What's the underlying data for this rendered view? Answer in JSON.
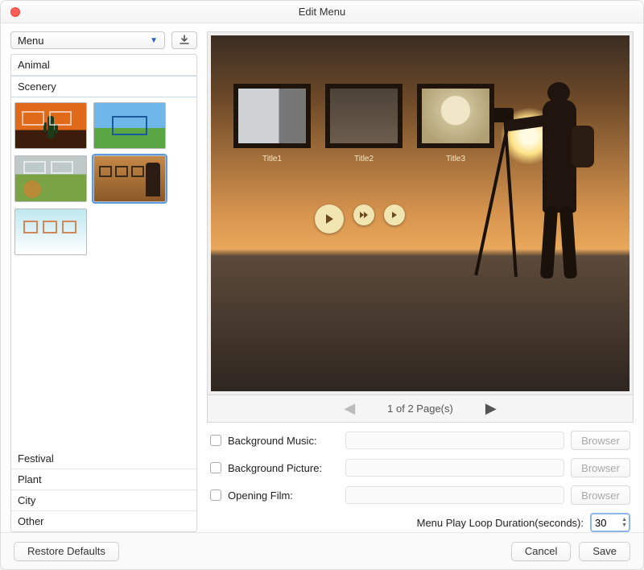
{
  "window": {
    "title": "Edit Menu"
  },
  "sidebar": {
    "combo_value": "Menu",
    "download_icon": "download-icon",
    "categories_top": [
      "Animal",
      "Scenery"
    ],
    "selected_category": "Scenery",
    "categories_bottom": [
      "Festival",
      "Plant",
      "City",
      "Other"
    ]
  },
  "preview": {
    "titles": [
      "Title1",
      "Title2",
      "Title3"
    ],
    "controls": {
      "play": "play-icon",
      "skip": "skip-icon",
      "next": "next-icon"
    }
  },
  "pager": {
    "text": "1 of 2 Page(s)",
    "prev_enabled": false,
    "next_enabled": true
  },
  "options": {
    "rows": [
      {
        "label": "Background Music:",
        "browse": "Browser"
      },
      {
        "label": "Background Picture:",
        "browse": "Browser"
      },
      {
        "label": "Opening Film:",
        "browse": "Browser"
      }
    ],
    "loop_label": "Menu Play Loop Duration(seconds):",
    "loop_value": "30"
  },
  "footer": {
    "restore": "Restore Defaults",
    "cancel": "Cancel",
    "save": "Save"
  }
}
